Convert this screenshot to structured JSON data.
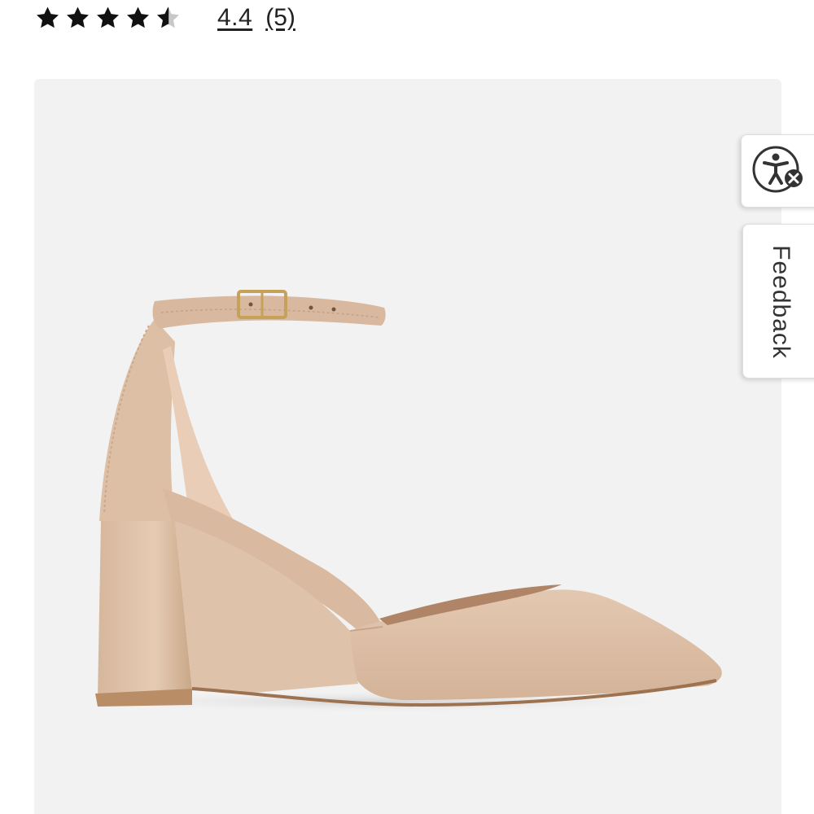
{
  "rating": {
    "value": "4.4",
    "count": "(5)",
    "stars_filled": 4.4,
    "stars_total": 5,
    "star_color": "#111111",
    "star_empty_color": "#c8c8c8"
  },
  "product": {
    "image_icon": "shoe-image",
    "background_color": "#f2f2f2",
    "shoe_color": "#dcbfa6"
  },
  "widgets": {
    "accessibility_icon": "accessibility-icon",
    "feedback_label": "Feedback"
  }
}
